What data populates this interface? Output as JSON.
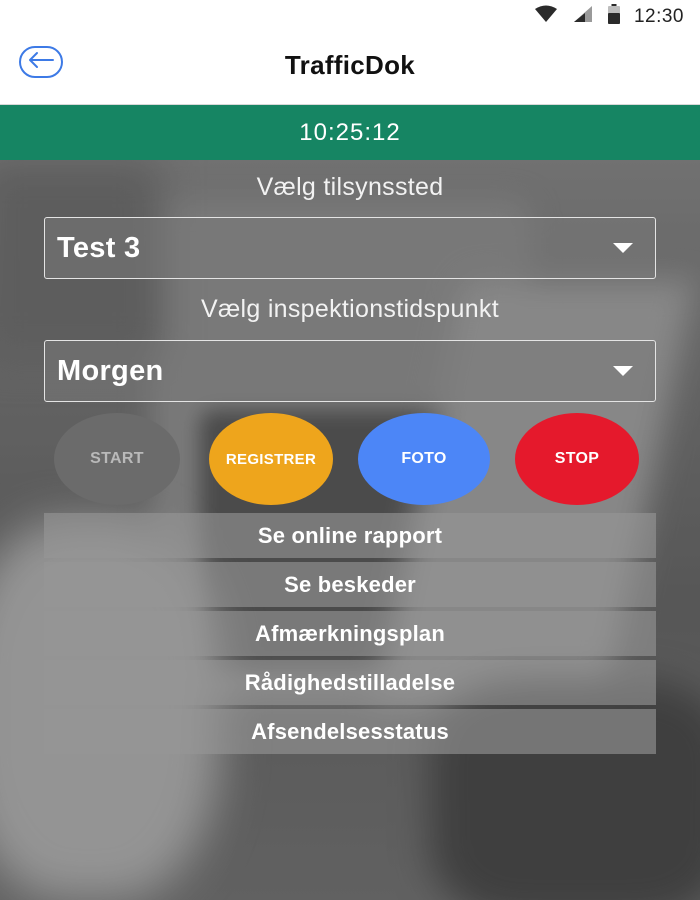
{
  "status_bar": {
    "time": "12:30",
    "icons": [
      "wifi-icon",
      "cell-signal-icon",
      "battery-icon"
    ]
  },
  "header": {
    "title": "TrafficDok",
    "back_icon": "back-arrow-icon"
  },
  "timer": {
    "value": "10:25:12"
  },
  "site": {
    "label": "Vælg  tilsynssted",
    "selected": "Test 3"
  },
  "inspection_time": {
    "label": "Vælg inspektionstidspunkt",
    "selected": "Morgen"
  },
  "actions": {
    "start": "START",
    "registrer": "REGISTRER",
    "foto": "FOTO",
    "stop": "STOP"
  },
  "menu": {
    "items": [
      {
        "label": "Se online rapport"
      },
      {
        "label": "Se beskeder"
      },
      {
        "label": "Afmærkningsplan"
      },
      {
        "label": "Rådighedstilladelse"
      },
      {
        "label": "Afsendelsesstatus"
      }
    ]
  },
  "colors": {
    "timer_bar": "#168563",
    "start": "#6b6b6b",
    "registrer": "#eea51c",
    "foto": "#4c86f7",
    "stop": "#e5192c",
    "back_accent": "#3d7ae6"
  }
}
